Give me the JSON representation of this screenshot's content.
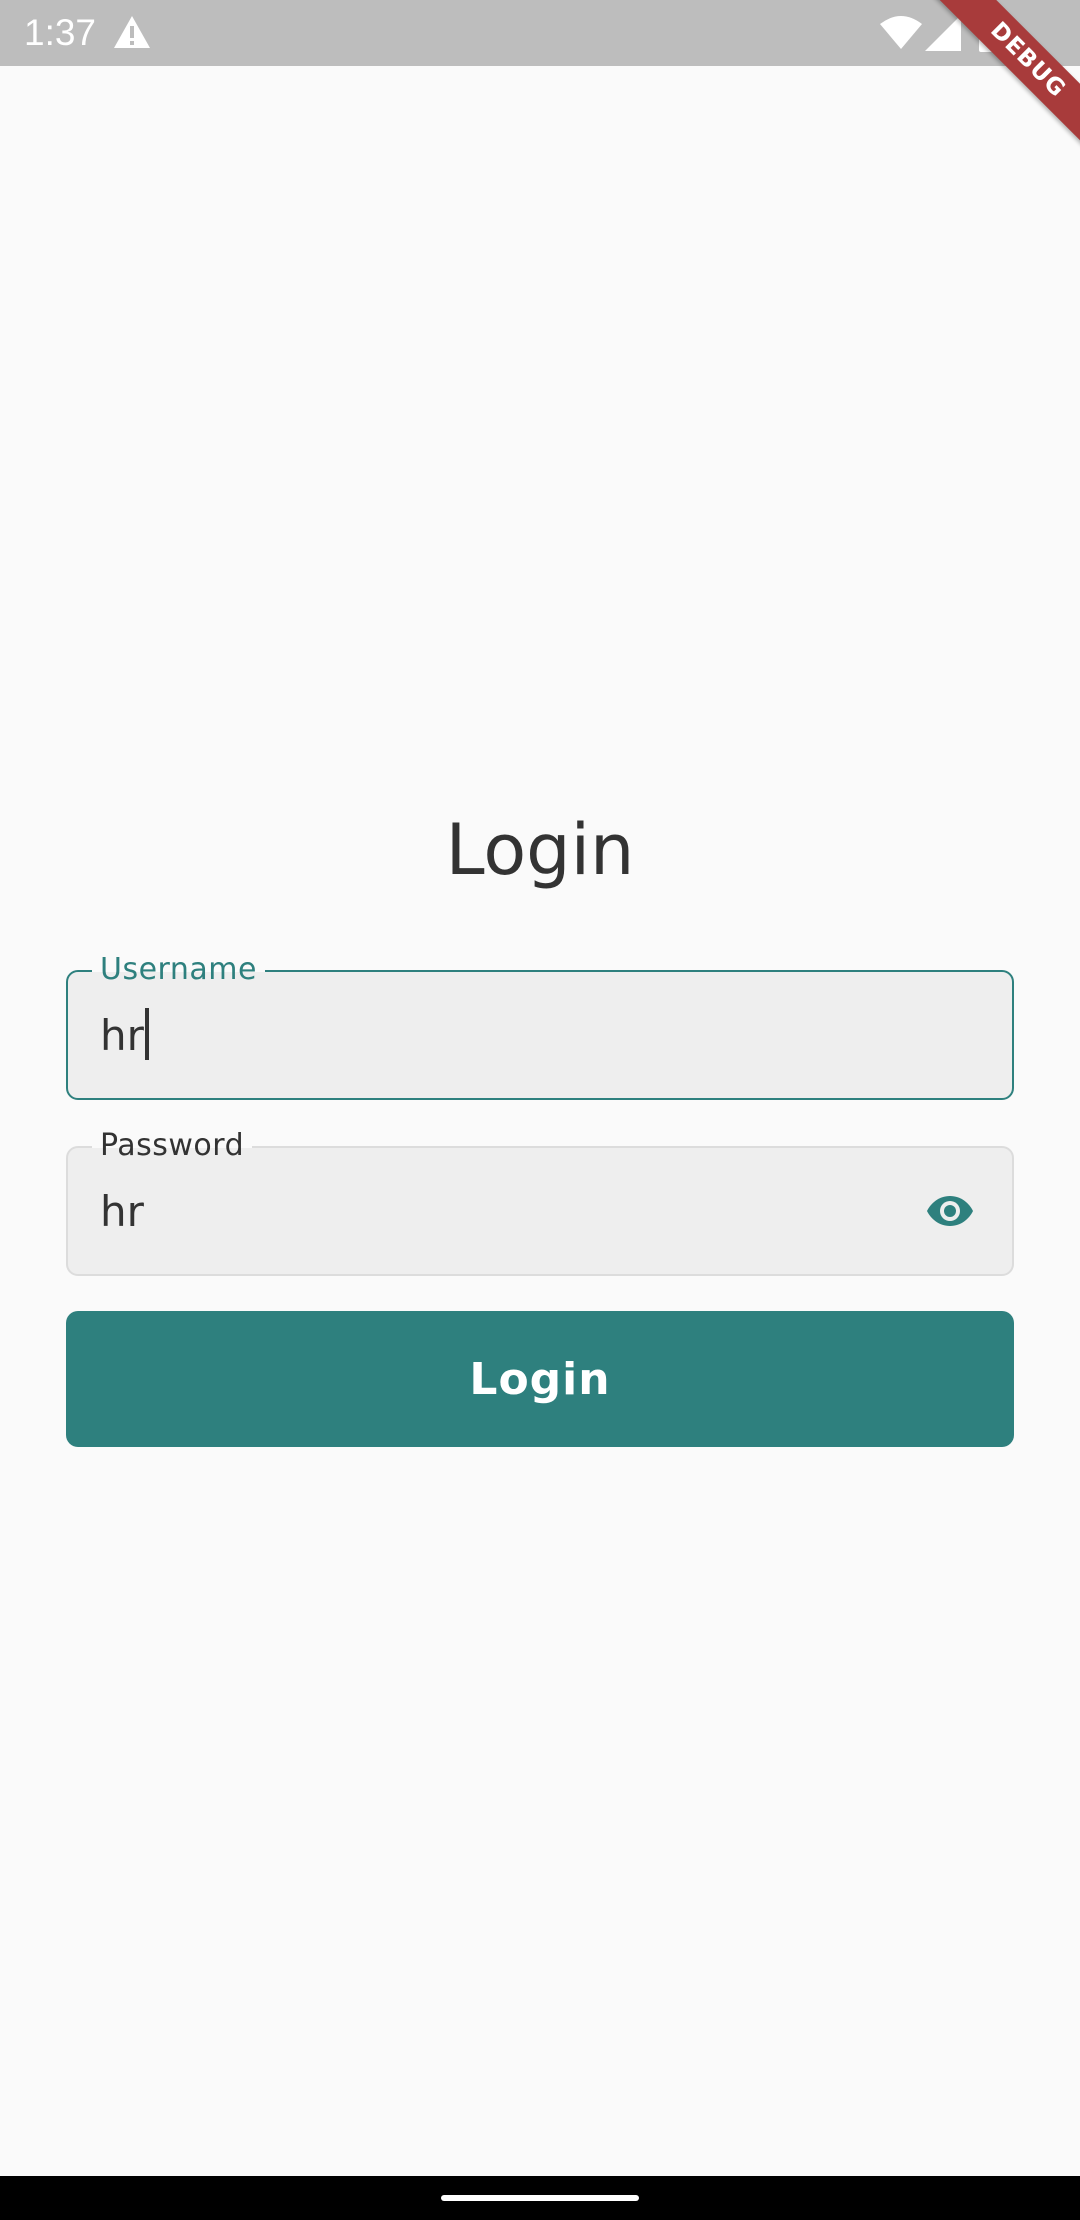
{
  "status_bar": {
    "time": "1:37",
    "icons": [
      "warning-icon",
      "wifi-icon",
      "signal-icon",
      "battery-icon"
    ]
  },
  "debug_banner": "DEBUG",
  "title": "Login",
  "username": {
    "label": "Username",
    "value": "hr",
    "focused": true
  },
  "password": {
    "label": "Password",
    "value": "hr",
    "visibility_icon": "eye-icon"
  },
  "login_button": "Login",
  "colors": {
    "accent": "#2e807e",
    "background": "#fafafa",
    "field_fill": "#eeeeee",
    "text": "#333333",
    "debug_ribbon": "#a83b3b"
  }
}
